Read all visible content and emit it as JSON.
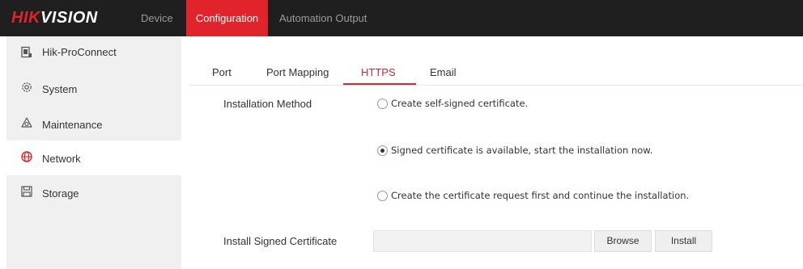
{
  "header": {
    "logo_brand": "HIK",
    "logo_suffix": "VISION",
    "nav": {
      "device": "Device",
      "configuration": "Configuration",
      "automation_output": "Automation Output"
    },
    "active_nav": "Configuration",
    "accent_color": "#e1242b"
  },
  "sidebar": {
    "items": [
      {
        "label": "Hik-ProConnect",
        "icon": "hik-proconnect-icon"
      },
      {
        "label": "System",
        "icon": "gear-icon"
      },
      {
        "label": "Maintenance",
        "icon": "maintenance-icon"
      },
      {
        "label": "Network",
        "icon": "globe-icon"
      },
      {
        "label": "Storage",
        "icon": "storage-icon"
      }
    ],
    "active": "Network"
  },
  "tabs": {
    "items": [
      "Port",
      "Port Mapping",
      "HTTPS",
      "Email"
    ],
    "active": "HTTPS"
  },
  "form": {
    "installation_method_label": "Installation Method",
    "options": [
      {
        "label": "Create self-signed certificate.",
        "checked": false
      },
      {
        "label": "Signed certificate is available, start the installation now.",
        "checked": true
      },
      {
        "label": "Create the certificate request first and continue the installation.",
        "checked": false
      }
    ],
    "install_signed_certificate_label": "Install Signed Certificate",
    "certificate_path_value": "",
    "browse_label": "Browse",
    "install_label": "Install"
  }
}
